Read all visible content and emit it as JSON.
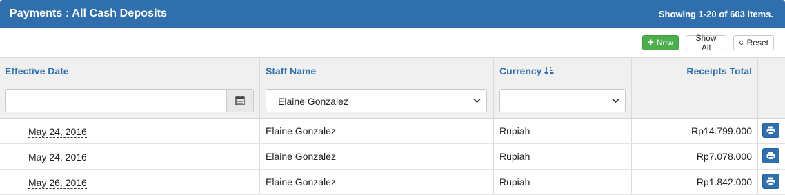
{
  "header": {
    "title": "Payments : All Cash Deposits",
    "summary": "Showing 1-20 of 603 items."
  },
  "toolbar": {
    "new_label": "New",
    "new_icon": "plus-icon",
    "show_all_label": "Show All",
    "reset_label": "Reset",
    "reset_icon": "refresh-icon"
  },
  "columns": {
    "effective_date": "Effective Date",
    "staff_name": "Staff Name",
    "currency": "Currency",
    "receipts_total": "Receipts Total"
  },
  "filters": {
    "effective_date_value": "",
    "staff_name_selected": "Elaine Gonzalez",
    "currency_selected": ""
  },
  "rows": [
    {
      "effective_date": "May 24, 2016",
      "staff_name": "Elaine Gonzalez",
      "currency": "Rupiah",
      "receipts_total": "Rp14.799.000"
    },
    {
      "effective_date": "May 24, 2016",
      "staff_name": "Elaine Gonzalez",
      "currency": "Rupiah",
      "receipts_total": "Rp7.078.000"
    },
    {
      "effective_date": "May 26, 2016",
      "staff_name": "Elaine Gonzalez",
      "currency": "Rupiah",
      "receipts_total": "Rp1.842.000"
    }
  ],
  "colors": {
    "header_bg": "#2f6fad",
    "new_button_bg": "#4cae4c",
    "column_header_text": "#2f6fad"
  }
}
